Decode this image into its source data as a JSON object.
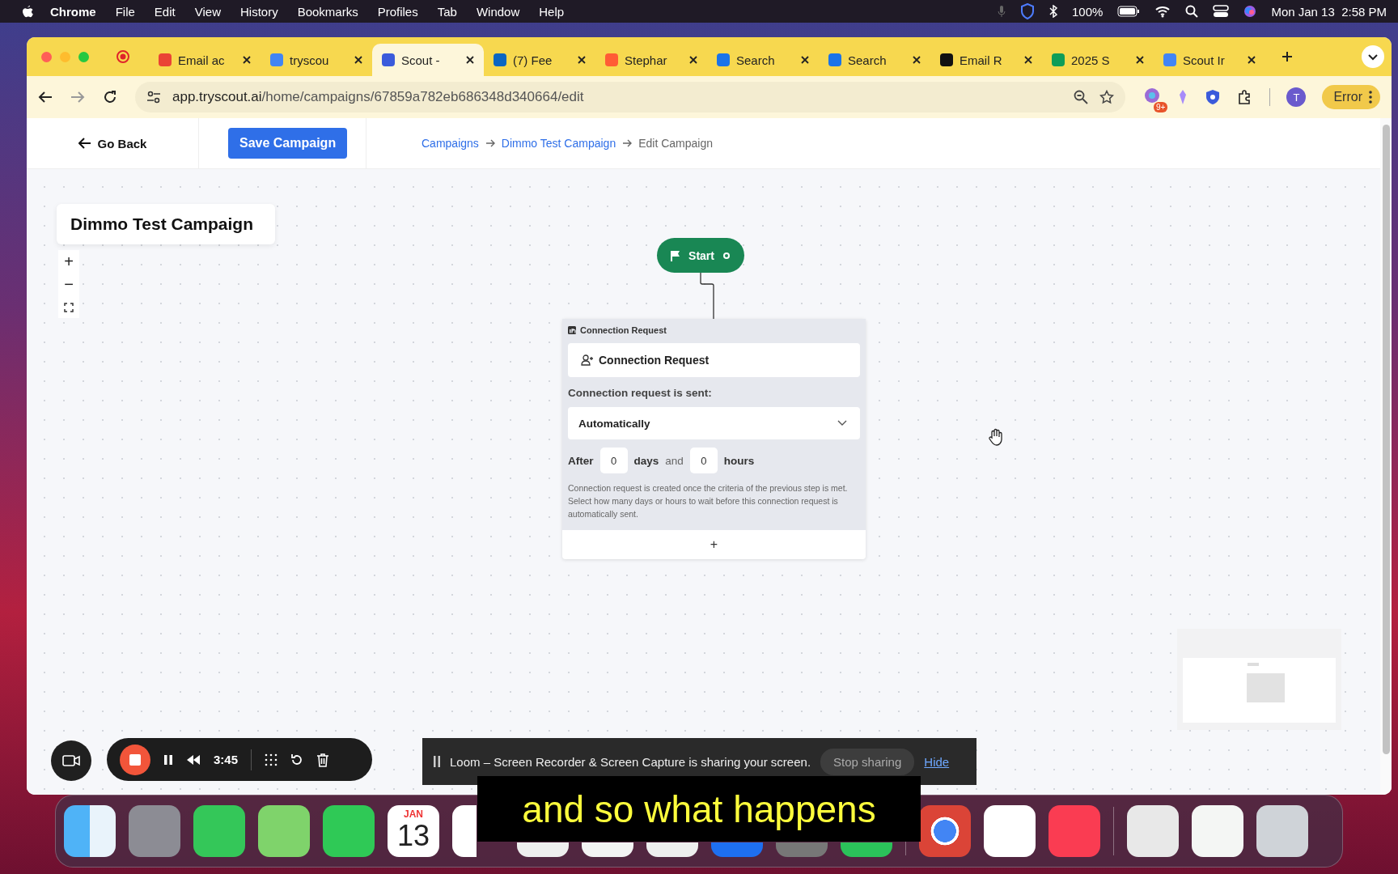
{
  "menu_bar": {
    "app": "Chrome",
    "menus": [
      "File",
      "Edit",
      "View",
      "History",
      "Bookmarks",
      "Profiles",
      "Tab",
      "Window",
      "Help"
    ],
    "battery": "100%",
    "clock": "Mon Jan 13  2:58 PM"
  },
  "browser": {
    "tabs": [
      {
        "title": "Email ac",
        "selected": false,
        "color": "#ea4335"
      },
      {
        "title": "tryscou",
        "selected": false,
        "color": "#4285f4"
      },
      {
        "title": "Scout -",
        "selected": true,
        "color": "#3b5bdb"
      },
      {
        "title": "(7) Fee",
        "selected": false,
        "color": "#0a66c2"
      },
      {
        "title": "Stephar",
        "selected": false,
        "color": "#ff5c35"
      },
      {
        "title": "Search",
        "selected": false,
        "color": "#1a73e8"
      },
      {
        "title": "Search",
        "selected": false,
        "color": "#1a73e8"
      },
      {
        "title": "Email R",
        "selected": false,
        "color": "#111111"
      },
      {
        "title": "2025 S",
        "selected": false,
        "color": "#0f9d58"
      },
      {
        "title": "Scout Ir",
        "selected": false,
        "color": "#4285f4"
      }
    ],
    "url_host": "app.tryscout.ai",
    "url_path": "/home/campaigns/67859a782eb686348d340664/edit",
    "extension_badge": "9+",
    "profile_initial": "T",
    "error_label": "Error"
  },
  "page": {
    "go_back": "Go Back",
    "save_button": "Save Campaign",
    "breadcrumbs": [
      {
        "label": "Campaigns",
        "link": true
      },
      {
        "label": "Dimmo Test Campaign",
        "link": true
      },
      {
        "label": "Edit Campaign",
        "link": false
      }
    ],
    "campaign_title": "Dimmo Test Campaign",
    "zoom_in": "+",
    "zoom_out": "−"
  },
  "start_node": {
    "label": "Start"
  },
  "step": {
    "header": "Connection Request",
    "action": "Connection Request",
    "sent_label": "Connection request is sent:",
    "mode": "Automatically",
    "after": "After",
    "days": "0",
    "days_label": "days",
    "and": "and",
    "hours": "0",
    "hours_label": "hours",
    "help": "Connection request is created once the criteria of the previous step is met. Select how many days or hours to wait before this connection request is automatically sent.",
    "add": "+"
  },
  "loom": {
    "time": "3:45",
    "message": "Loom – Screen Recorder & Screen Capture is sharing your screen.",
    "stop": "Stop sharing",
    "hide": "Hide"
  },
  "dock": {
    "calendar_month": "JAN",
    "calendar_day": "13"
  },
  "caption": "and so what happens"
}
